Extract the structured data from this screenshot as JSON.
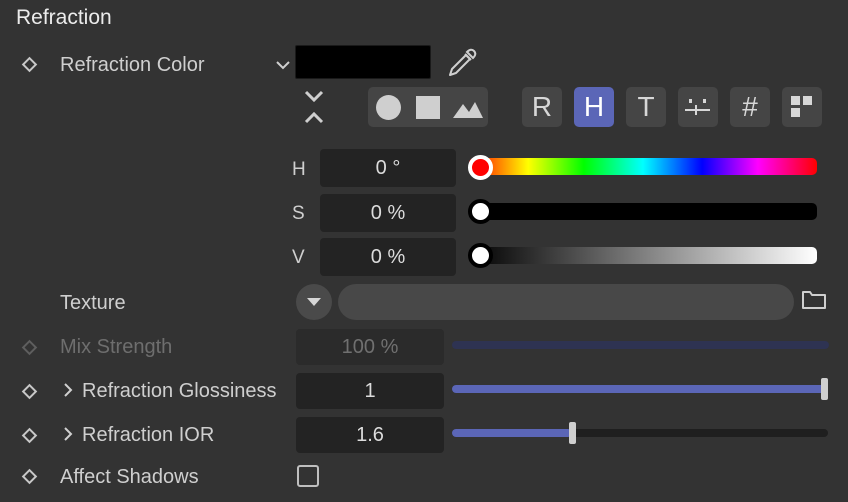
{
  "section_title": "Refraction",
  "refraction_color": {
    "label": "Refraction Color",
    "swatch_color": "#000000"
  },
  "picker_modes": [
    "R",
    "H",
    "T",
    "#"
  ],
  "hsv": {
    "h_label": "H",
    "h_value": "0 °",
    "s_label": "S",
    "s_value": "0 %",
    "v_label": "V",
    "v_value": "0 %"
  },
  "texture": {
    "label": "Texture"
  },
  "mix_strength": {
    "label": "Mix Strength",
    "value": "100 %",
    "fraction": 1.0
  },
  "glossiness": {
    "label": "Refraction Glossiness",
    "value": "1",
    "fraction": 1.0
  },
  "ior": {
    "label": "Refraction IOR",
    "value": "1.6",
    "fraction": 0.32
  },
  "affect_shadows": {
    "label": "Affect Shadows",
    "checked": false
  },
  "colors": {
    "accent": "#5b66b7",
    "track_fill": "#5b66b7",
    "track_bg": "#1f1f1f"
  }
}
